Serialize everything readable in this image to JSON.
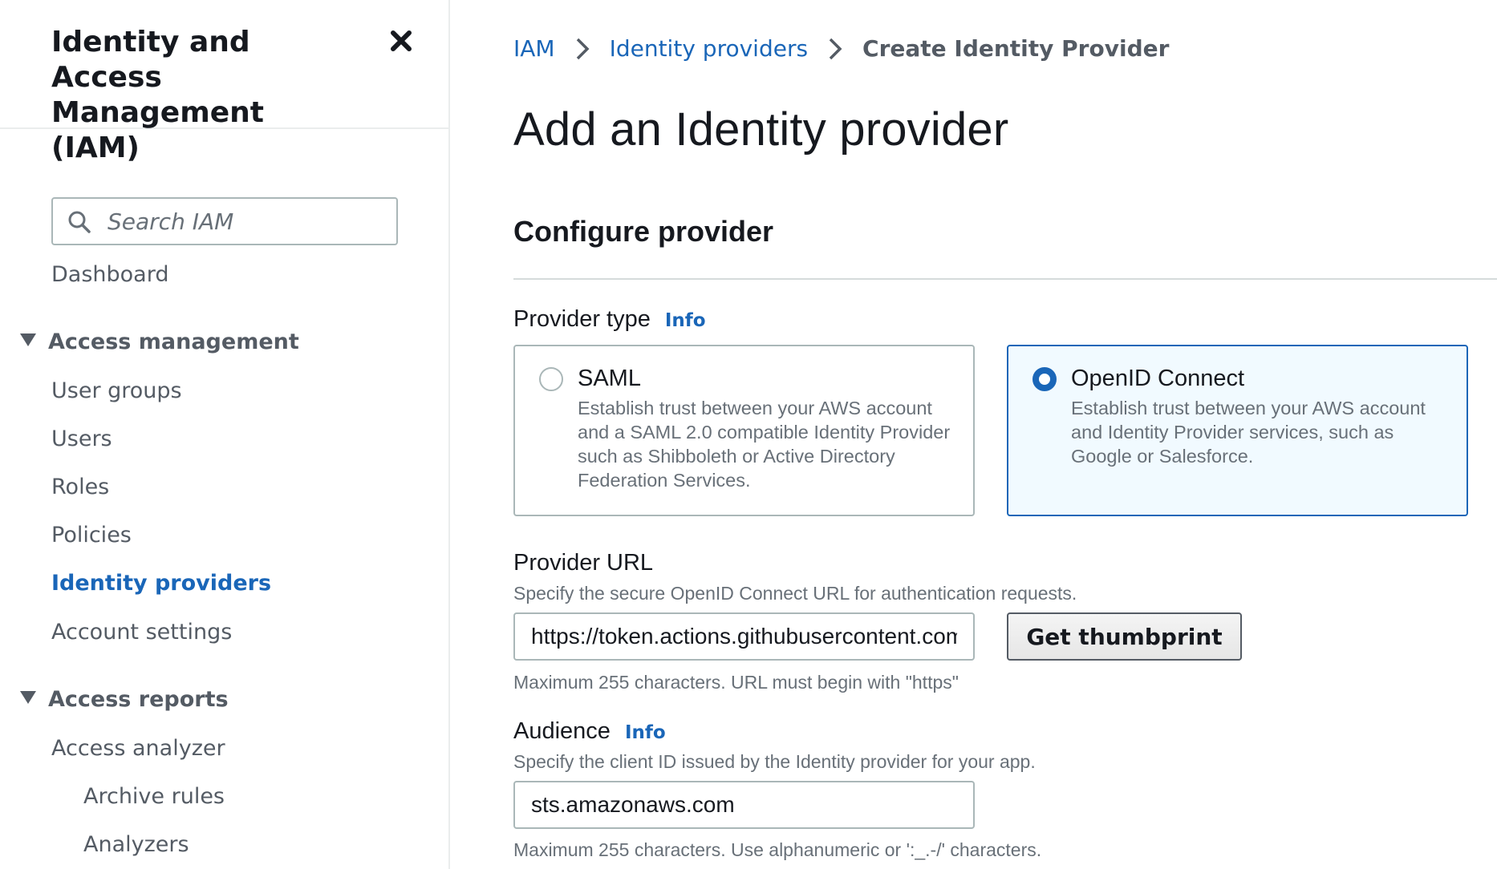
{
  "sidebar": {
    "title": "Identity and Access Management (IAM)",
    "search_placeholder": "Search IAM",
    "dashboard": "Dashboard",
    "access_management": {
      "label": "Access management",
      "items": [
        "User groups",
        "Users",
        "Roles",
        "Policies",
        "Identity providers",
        "Account settings"
      ],
      "active": "Identity providers"
    },
    "access_reports": {
      "label": "Access reports",
      "items": [
        "Access analyzer"
      ],
      "sub_items": [
        "Archive rules",
        "Analyzers"
      ]
    }
  },
  "breadcrumb": {
    "items": [
      "IAM",
      "Identity providers",
      "Create Identity Provider"
    ]
  },
  "page_title": "Add an Identity provider",
  "configure": {
    "title": "Configure provider",
    "provider_type": {
      "label": "Provider type",
      "info": "Info",
      "options": [
        {
          "title": "SAML",
          "description": "Establish trust between your AWS account and a SAML 2.0 compatible Identity Provider such as Shibboleth or Active Directory Federation Services.",
          "selected": false
        },
        {
          "title": "OpenID Connect",
          "description": "Establish trust between your AWS account and Identity Provider services, such as Google or Salesforce.",
          "selected": true
        }
      ]
    },
    "provider_url": {
      "label": "Provider URL",
      "description": "Specify the secure OpenID Connect URL for authentication requests.",
      "value": "https://token.actions.githubusercontent.com",
      "hint": "Maximum 255 characters. URL must begin with \"https\"",
      "button": "Get thumbprint"
    },
    "audience": {
      "label": "Audience",
      "info": "Info",
      "description": "Specify the client ID issued by the Identity provider for your app.",
      "value": "sts.amazonaws.com",
      "hint": "Maximum 255 characters. Use alphanumeric or ':_.-/' characters."
    }
  },
  "colors": {
    "link": "#1a66b8",
    "selected_card_bg": "#f1faff",
    "border": "#aab7b8",
    "muted_text": "#687078"
  }
}
